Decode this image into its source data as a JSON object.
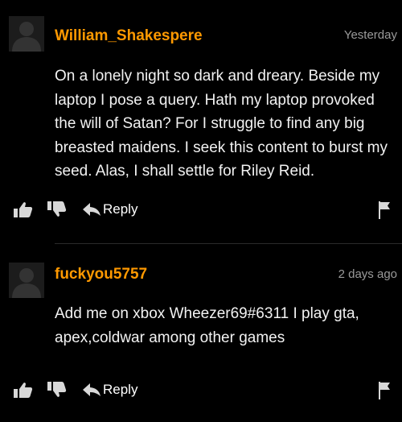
{
  "comments": [
    {
      "username": "William_Shakespere",
      "timestamp": "Yesterday",
      "text": "On a lonely night so dark and dreary. Beside my laptop I pose a query. Hath my laptop provoked the will of Satan? For I struggle to find any big breasted maidens. I seek this content to burst my seed. Alas, I shall settle for Riley Reid.",
      "reply_label": "Reply"
    },
    {
      "username": "fuckyou5757",
      "timestamp": "2 days ago",
      "text": "Add me on xbox Wheezer69#6311 I play gta, apex,coldwar among other games",
      "reply_label": "Reply"
    }
  ],
  "icons": {
    "avatar": "default-user-silhouette",
    "like": "thumbs-up-icon",
    "dislike": "thumbs-down-icon",
    "reply": "reply-arrow-icon",
    "report": "flag-icon"
  },
  "colors": {
    "background": "#000000",
    "username": "#ff9900",
    "timestamp": "#9a9a9a",
    "text": "#f2f2f2",
    "icons": "#d8d8d8"
  }
}
